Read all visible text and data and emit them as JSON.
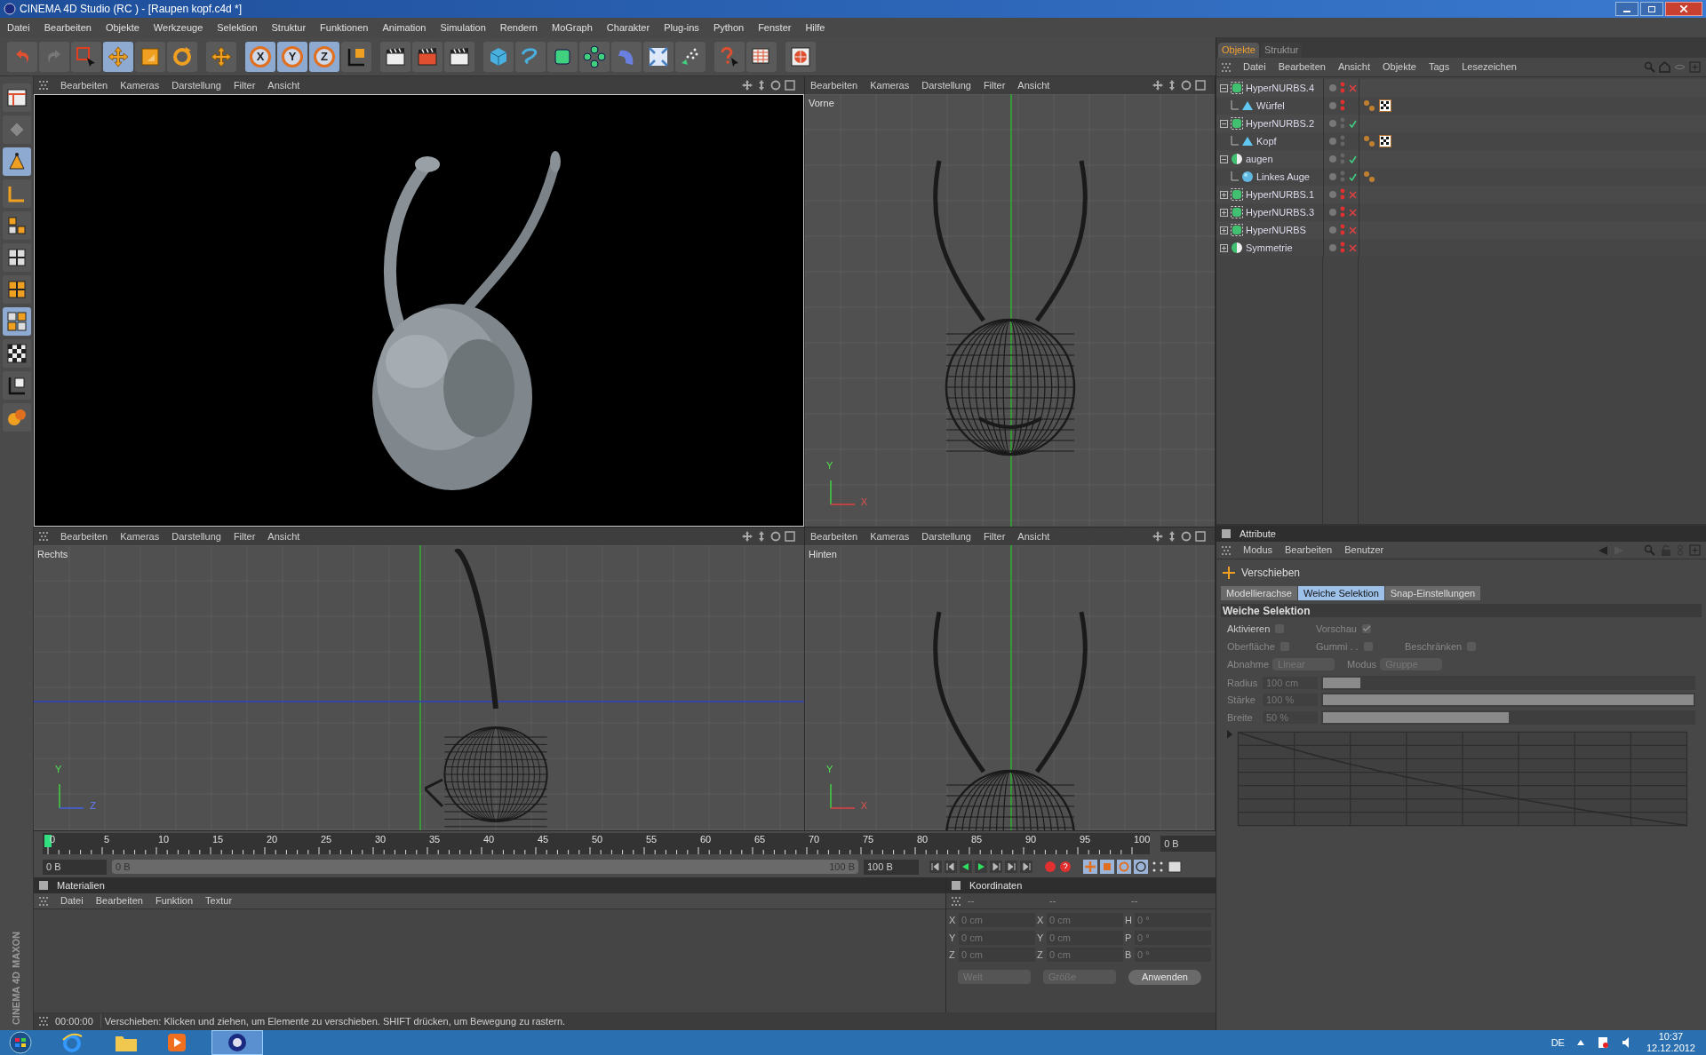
{
  "window": {
    "title": "CINEMA 4D Studio (RC ) - [Raupen kopf.c4d *]"
  },
  "menu": [
    "Datei",
    "Bearbeiten",
    "Objekte",
    "Werkzeuge",
    "Selektion",
    "Struktur",
    "Funktionen",
    "Animation",
    "Simulation",
    "Rendern",
    "MoGraph",
    "Charakter",
    "Plug-ins",
    "Python",
    "Fenster",
    "Hilfe"
  ],
  "toolbar": [
    {
      "kind": "undo",
      "selected": false
    },
    {
      "kind": "redo",
      "selected": false
    },
    {
      "kind": "select",
      "selected": false
    },
    {
      "kind": "move",
      "selected": true
    },
    {
      "kind": "scale",
      "selected": false
    },
    {
      "kind": "rotate",
      "selected": false
    },
    {
      "kind": "plus",
      "selected": false
    },
    {
      "kind": "axis",
      "label": "X",
      "selected": true
    },
    {
      "kind": "axis",
      "label": "Y",
      "selected": true
    },
    {
      "kind": "axis",
      "label": "Z",
      "selected": true
    },
    {
      "kind": "coords",
      "selected": false
    },
    {
      "kind": "render-view",
      "selected": false
    },
    {
      "kind": "render-pic",
      "selected": false
    },
    {
      "kind": "render-settings",
      "selected": false
    },
    {
      "kind": "cube",
      "selected": false
    },
    {
      "kind": "spline",
      "selected": false
    },
    {
      "kind": "nurbs",
      "selected": false
    },
    {
      "kind": "array",
      "selected": false
    },
    {
      "kind": "deformer",
      "selected": false
    },
    {
      "kind": "scene",
      "selected": false
    },
    {
      "kind": "particles",
      "selected": false
    },
    {
      "kind": "help",
      "selected": false
    },
    {
      "kind": "layout",
      "selected": false
    },
    {
      "kind": "browser",
      "selected": false
    }
  ],
  "left_tools": [
    {
      "kind": "layout",
      "selected": false
    },
    {
      "kind": "model",
      "selected": false
    },
    {
      "kind": "points",
      "selected": true
    },
    {
      "kind": "edges",
      "selected": false
    },
    {
      "kind": "polygons",
      "selected": false
    },
    {
      "kind": "grid",
      "selected": false
    },
    {
      "kind": "grid-orange",
      "selected": false
    },
    {
      "kind": "cubes",
      "selected": true
    },
    {
      "kind": "checker",
      "selected": false
    },
    {
      "kind": "texture-axis",
      "selected": false
    },
    {
      "kind": "paint",
      "selected": false
    }
  ],
  "viewports": [
    {
      "kind": "perspective",
      "menu": [
        "Bearbeiten",
        "Kameras",
        "Darstellung",
        "Filter",
        "Ansicht"
      ]
    },
    {
      "kind": "front",
      "label": "Vorne",
      "menu": [
        "Bearbeiten",
        "Kameras",
        "Darstellung",
        "Filter",
        "Ansicht"
      ],
      "axes": [
        "Y",
        "X"
      ]
    },
    {
      "kind": "side",
      "label": "Rechts",
      "menu": [
        "Bearbeiten",
        "Kameras",
        "Darstellung",
        "Filter",
        "Ansicht"
      ],
      "axes": [
        "Y",
        "Z"
      ]
    },
    {
      "kind": "back",
      "label": "Hinten",
      "menu": [
        "Bearbeiten",
        "Kameras",
        "Darstellung",
        "Filter",
        "Ansicht"
      ],
      "axes": [
        "Y",
        "X"
      ]
    }
  ],
  "timeline": {
    "ticks": [
      "0",
      "5",
      "10",
      "15",
      "20",
      "25",
      "30",
      "35",
      "40",
      "45",
      "50",
      "55",
      "60",
      "65",
      "70",
      "75",
      "80",
      "85",
      "90",
      "95",
      "100"
    ],
    "current": "0 B",
    "start": "0 B",
    "range_start": "0 B",
    "range_end": "100 B",
    "end": "100 B"
  },
  "materials": {
    "title": "Materialien",
    "menu": [
      "Datei",
      "Bearbeiten",
      "Funktion",
      "Textur"
    ]
  },
  "coordinates": {
    "title": "Koordinaten",
    "headers": [
      "--",
      "--",
      "--"
    ],
    "rows": [
      [
        {
          "label": "X",
          "value": "0 cm"
        },
        {
          "label": "X",
          "value": "0 cm"
        },
        {
          "label": "H",
          "value": "0 °"
        }
      ],
      [
        {
          "label": "Y",
          "value": "0 cm"
        },
        {
          "label": "Y",
          "value": "0 cm"
        },
        {
          "label": "P",
          "value": "0 °"
        }
      ],
      [
        {
          "label": "Z",
          "value": "0 cm"
        },
        {
          "label": "Z",
          "value": "0 cm"
        },
        {
          "label": "B",
          "value": "0 °"
        }
      ]
    ],
    "dropdowns": [
      "Welt",
      "Größe"
    ],
    "apply": "Anwenden"
  },
  "status_bar": {
    "time": "00:00:00",
    "message": "Verschieben: Klicken und ziehen, um Elemente zu verschieben. SHIFT drücken, um Bewegung zu rastern."
  },
  "logo": [
    "MAXON",
    "CINEMA 4D"
  ],
  "object_manager": {
    "tabs": [
      {
        "label": "Objekte",
        "selected": true
      },
      {
        "label": "Struktur",
        "selected": false
      }
    ],
    "menu": [
      "Datei",
      "Bearbeiten",
      "Ansicht",
      "Objekte",
      "Tags",
      "Lesezeichen"
    ],
    "objects": [
      {
        "name": "HyperNURBS.4",
        "kind": "hypernurbs",
        "hidden": true,
        "enabled": false,
        "collapsed": false,
        "children": [
          {
            "name": "Würfel",
            "kind": "polygon",
            "hidden": true,
            "tags": [
              {
                "kind": "phong"
              },
              {
                "kind": "texture"
              }
            ]
          }
        ]
      },
      {
        "name": "HyperNURBS.2",
        "kind": "hypernurbs",
        "hidden": false,
        "enabled": true,
        "collapsed": false,
        "children": [
          {
            "name": "Kopf",
            "kind": "polygon",
            "hidden": false,
            "tags": [
              {
                "kind": "phong"
              },
              {
                "kind": "texture"
              }
            ]
          }
        ]
      },
      {
        "name": "augen",
        "kind": "symmetry",
        "hidden": false,
        "enabled": true,
        "collapsed": false,
        "children": [
          {
            "name": "Linkes Auge",
            "kind": "sphere",
            "hidden": false,
            "enabled": true,
            "tags": [
              {
                "kind": "phong"
              }
            ]
          }
        ]
      },
      {
        "name": "HyperNURBS.1",
        "kind": "hypernurbs",
        "hidden": true,
        "enabled": false,
        "collapsed": true
      },
      {
        "name": "HyperNURBS.3",
        "kind": "hypernurbs",
        "hidden": true,
        "enabled": false,
        "collapsed": true
      },
      {
        "name": "HyperNURBS",
        "kind": "hypernurbs",
        "hidden": true,
        "enabled": false,
        "collapsed": true
      },
      {
        "name": "Symmetrie",
        "kind": "symmetry",
        "hidden": true,
        "enabled": false,
        "collapsed": true
      }
    ]
  },
  "attributes": {
    "title": "Attribute",
    "menu": [
      "Modus",
      "Bearbeiten",
      "Benutzer"
    ],
    "tool": "Verschieben",
    "tabs": [
      {
        "label": "Modellierachse",
        "selected": false
      },
      {
        "label": "Weiche Selektion",
        "selected": true
      },
      {
        "label": "Snap-Einstellungen",
        "selected": false
      }
    ],
    "section": "Weiche Selektion",
    "checkboxes": [
      {
        "label": "Aktivieren",
        "checked": false,
        "disabled": false
      },
      {
        "label": "Vorschau",
        "checked": true,
        "disabled": true
      },
      {
        "label": "Oberfläche",
        "checked": false,
        "disabled": true
      },
      {
        "label": "Gummi . .",
        "checked": false,
        "disabled": true
      },
      {
        "label": "Beschränken",
        "checked": false,
        "disabled": true
      }
    ],
    "dropdowns": [
      {
        "label": "Abnahme",
        "value": "Linear"
      },
      {
        "label": "Modus",
        "value": "Gruppe"
      }
    ],
    "sliders": [
      {
        "label": "Radius",
        "value": "100 cm",
        "level": 0.1
      },
      {
        "label": "Stärke",
        "value": "100 %",
        "level": 1
      },
      {
        "label": "Breite",
        "value": "50 %",
        "level": 0.5
      }
    ]
  },
  "taskbar": {
    "language": "DE",
    "time": "10:37",
    "date": "12.12.2012"
  }
}
